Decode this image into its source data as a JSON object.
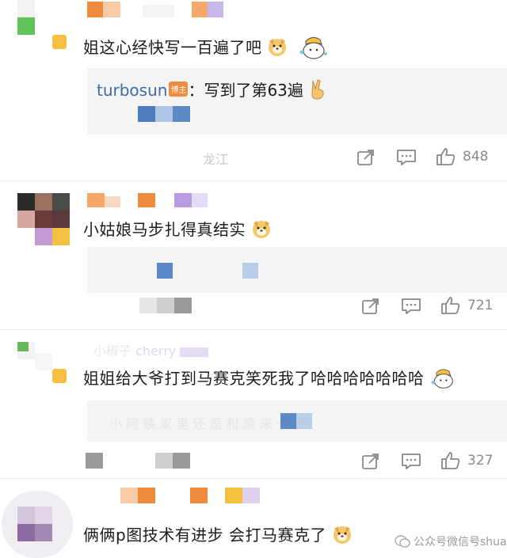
{
  "comments": [
    {
      "text": "姐这心经快写一百遍了吧",
      "reply": {
        "author": "turbosun",
        "badge": "博主",
        "text": "：写到了第63遍"
      },
      "location": "龙江",
      "likes": "848"
    },
    {
      "text": "小姑娘马步扎得真结实",
      "likes": "721"
    },
    {
      "username_partial": "cherry",
      "text": "姐姐给大爷打到马赛克笑死我了哈哈哈哈哈哈哈",
      "likes": "327"
    },
    {
      "text": "俩俩p图技术有进步 会打马赛克了"
    }
  ],
  "watermark": "公众号微信号shuaf",
  "colors": {
    "text": "#1c1c1c",
    "reply_author": "#3d6ca8",
    "badge": "#f08a3c",
    "action": "#8a8a8a"
  },
  "icons": [
    "share-icon",
    "comment-icon",
    "thumbs-up-icon",
    "dog-emoji",
    "chick-emoji",
    "victory-hand-emoji"
  ]
}
